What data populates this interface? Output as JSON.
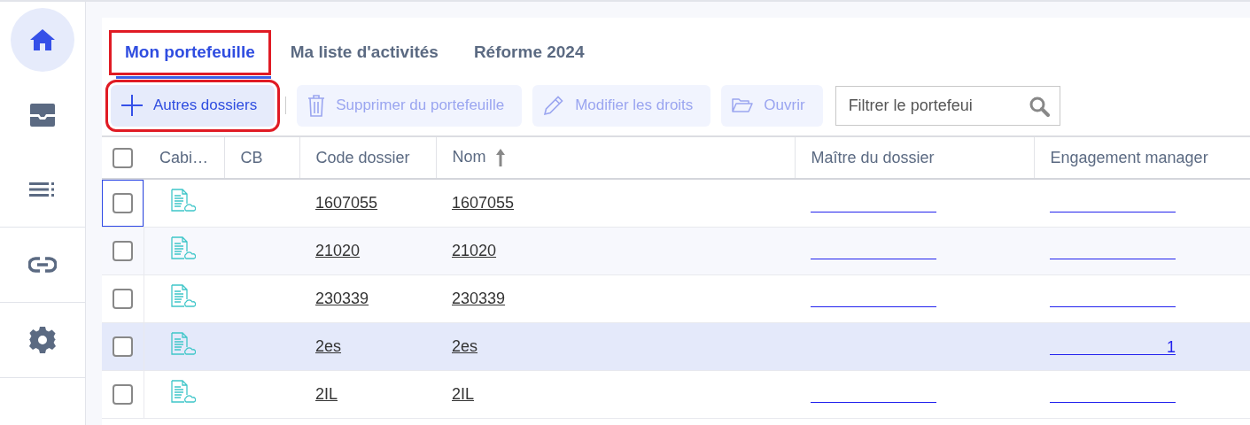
{
  "sidebar": {
    "items": [
      {
        "kind": "home",
        "selected": true
      },
      {
        "kind": "inbox",
        "selected": false
      },
      {
        "kind": "list",
        "selected": false
      },
      {
        "kind": "link",
        "selected": false
      },
      {
        "kind": "settings",
        "selected": false
      }
    ]
  },
  "tabs": [
    {
      "label": "Mon portefeuille",
      "selected": true,
      "annotated": true
    },
    {
      "label": "Ma liste d'activités",
      "selected": false,
      "annotated": false
    },
    {
      "label": "Réforme 2024",
      "selected": false,
      "annotated": false
    }
  ],
  "toolbar": {
    "buttons": [
      {
        "kind": "add",
        "label": "Autres dossiers",
        "disabled": false,
        "annotated": true
      },
      {
        "kind": "delete",
        "label": "Supprimer du portefeuille",
        "disabled": true,
        "annotated": false
      },
      {
        "kind": "edit",
        "label": "Modifier les droits",
        "disabled": true,
        "annotated": false
      },
      {
        "kind": "open",
        "label": "Ouvrir",
        "disabled": true,
        "annotated": false
      }
    ],
    "filter": {
      "placeholder": "Filtrer le portefeui"
    }
  },
  "table": {
    "select_all_checked": false,
    "columns": [
      {
        "label": "Cabi…"
      },
      {
        "label": "CB"
      },
      {
        "label": "Code dossier"
      },
      {
        "label": "Nom",
        "sorted": true
      },
      {
        "label": "Maître du dossier"
      },
      {
        "label": "Engagement manager"
      }
    ],
    "rows": [
      {
        "checked": false,
        "focused": true,
        "highlighted": false,
        "code": "1607055",
        "name": "1607055",
        "master": {
          "underlined": true
        },
        "manager": {
          "underlined": true
        }
      },
      {
        "checked": false,
        "focused": false,
        "highlighted": false,
        "code": "21020",
        "name": "21020",
        "master": {
          "underlined": true
        },
        "manager": {
          "underlined": true
        }
      },
      {
        "checked": false,
        "focused": false,
        "highlighted": false,
        "code": "230339",
        "name": "230339",
        "master": {
          "underlined": true
        },
        "manager": {
          "underlined": true
        }
      },
      {
        "checked": false,
        "focused": false,
        "highlighted": true,
        "code": "2es",
        "name": "2es",
        "master": {
          "underlined": false
        },
        "manager": {
          "underlined": true,
          "text": "1"
        }
      },
      {
        "checked": false,
        "focused": false,
        "highlighted": false,
        "code": "2IL",
        "name": "2IL",
        "master": {
          "underlined": true
        },
        "manager": {
          "underlined": true
        }
      }
    ]
  }
}
